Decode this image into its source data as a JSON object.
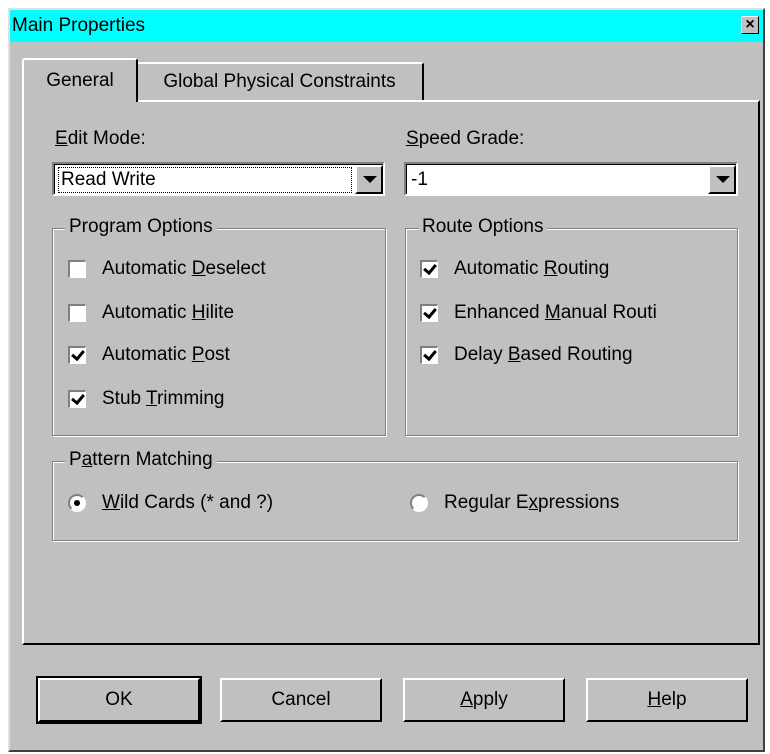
{
  "window": {
    "title": "Main Properties",
    "close_glyph": "×"
  },
  "tabs": [
    {
      "label": "General",
      "active": true
    },
    {
      "label": "Global Physical Constraints",
      "active": false
    }
  ],
  "edit_mode": {
    "label_pre": "",
    "label_ul": "E",
    "label_post": "dit Mode:",
    "value": "Read Write"
  },
  "speed_grade": {
    "label_pre": "",
    "label_ul": "S",
    "label_post": "peed Grade:",
    "value": "-1"
  },
  "program_options": {
    "title": "Program Options",
    "items": [
      {
        "pre": "Automatic ",
        "ul": "D",
        "post": "eselect",
        "checked": false
      },
      {
        "pre": "Automatic ",
        "ul": "H",
        "post": "ilite",
        "checked": false
      },
      {
        "pre": "Automatic ",
        "ul": "P",
        "post": "ost",
        "checked": true
      },
      {
        "pre": "Stub ",
        "ul": "T",
        "post": "rimming",
        "checked": true
      }
    ]
  },
  "route_options": {
    "title": "Route Options",
    "items": [
      {
        "pre": "Automatic ",
        "ul": "R",
        "post": "outing",
        "checked": true
      },
      {
        "pre": "Enhanced ",
        "ul": "M",
        "post": "anual Routi",
        "checked": true
      },
      {
        "pre": "Delay ",
        "ul": "B",
        "post": "ased Routing",
        "checked": true
      }
    ]
  },
  "pattern_matching": {
    "title_pre": "P",
    "title_ul": "a",
    "title_post": "ttern Matching",
    "options": [
      {
        "pre": "",
        "ul": "W",
        "post": "ild Cards (* and ?)",
        "selected": true
      },
      {
        "pre": "Regular E",
        "ul": "x",
        "post": "pressions",
        "selected": false
      }
    ]
  },
  "buttons": [
    {
      "pre": "OK",
      "ul": "",
      "post": ""
    },
    {
      "pre": "Cancel",
      "ul": "",
      "post": ""
    },
    {
      "pre": "",
      "ul": "A",
      "post": "pply"
    },
    {
      "pre": "",
      "ul": "H",
      "post": "elp"
    }
  ]
}
